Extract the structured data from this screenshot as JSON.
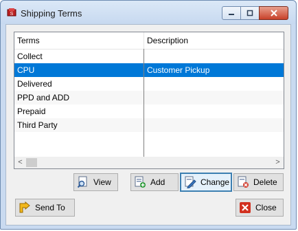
{
  "window": {
    "title": "Shipping Terms"
  },
  "grid": {
    "columns": [
      "Terms",
      "Description"
    ],
    "rows": [
      {
        "terms": "Collect",
        "description": ""
      },
      {
        "terms": "CPU",
        "description": "Customer Pickup"
      },
      {
        "terms": "Delivered",
        "description": ""
      },
      {
        "terms": "PPD and ADD",
        "description": ""
      },
      {
        "terms": "Prepaid",
        "description": ""
      },
      {
        "terms": "Third Party",
        "description": ""
      }
    ],
    "selected_index": 1,
    "scroll_left_glyph": "<",
    "scroll_right_glyph": ">"
  },
  "buttons": {
    "view": "View",
    "add": "Add",
    "change": "Change",
    "delete": "Delete",
    "send_to": "Send To",
    "close": "Close"
  },
  "icons": {
    "app": "app-icon",
    "view": "magnifier-document-icon",
    "add": "add-document-icon",
    "change": "edit-document-icon",
    "delete": "delete-document-icon",
    "send_to": "send-arrow-icon",
    "close": "close-x-icon"
  },
  "colors": {
    "selection": "#0078d7",
    "titlebar": "#c7d9f0",
    "close": "#c8412a"
  }
}
